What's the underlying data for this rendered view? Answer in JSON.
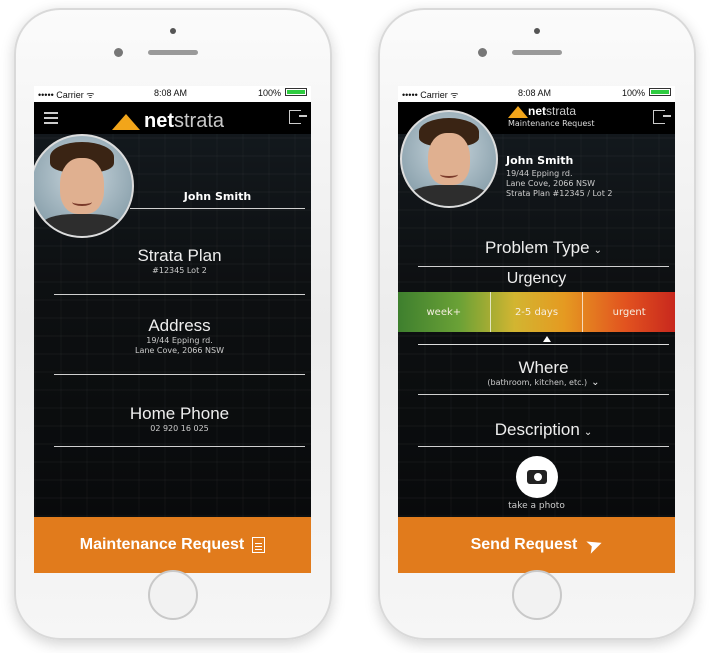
{
  "status_bar": {
    "carrier": "••••• Carrier ᯤ",
    "time": "8:08 AM",
    "battery": "100%"
  },
  "brand": {
    "net": "net",
    "strata": "strata",
    "accent": "#f2a51a",
    "footer_color": "#e17b1c"
  },
  "profile_screen": {
    "name": "John Smith",
    "fields": [
      {
        "label": "Strata Plan",
        "value": "#12345 Lot 2"
      },
      {
        "label": "Address",
        "value_line1": "19/44 Epping rd.",
        "value_line2": "Lane Cove, 2066 NSW"
      },
      {
        "label": "Home Phone",
        "value": "02 920 16 025"
      }
    ],
    "footer_label": "Maintenance Request",
    "footer_icon": "document-icon"
  },
  "request_screen": {
    "header_subtitle": "Maintenance Request",
    "name": "John Smith",
    "info_lines": [
      "19/44 Epping rd.",
      "Lane Cove, 2066 NSW",
      "Strata Plan #12345 / Lot 2"
    ],
    "problem_type": "Problem Type",
    "urgency_label": "Urgency",
    "urgency_options": [
      "week+",
      "2-5 days",
      "urgent"
    ],
    "urgency_selected": "2-5 days",
    "where_label": "Where",
    "where_hint": "(bathroom, kitchen, etc.)",
    "description_label": "Description",
    "photo_label": "take a photo",
    "footer_label": "Send Request",
    "footer_icon": "send-icon"
  }
}
